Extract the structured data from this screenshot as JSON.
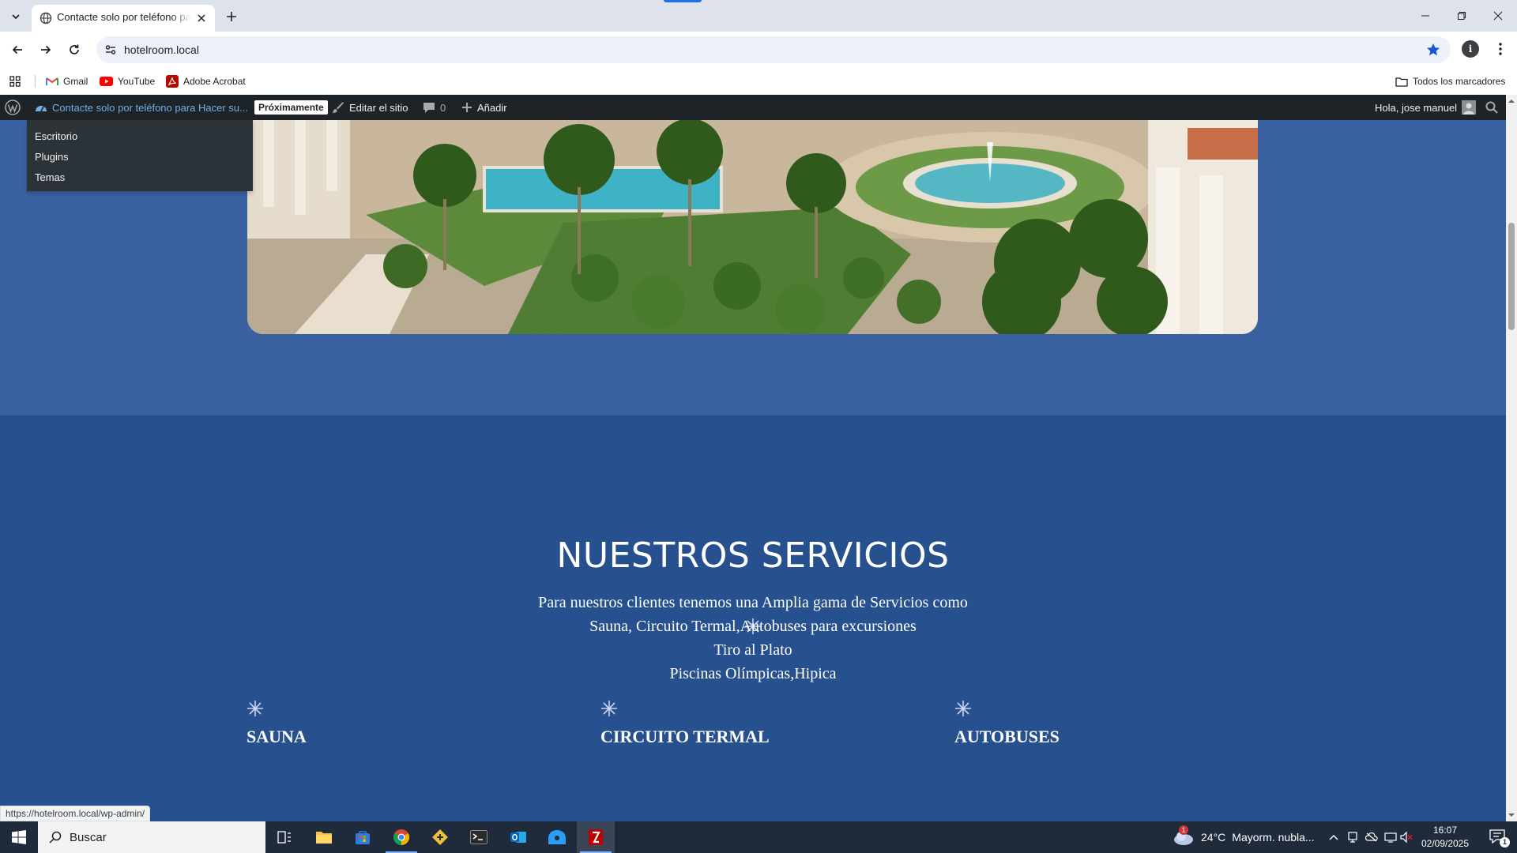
{
  "browser": {
    "tab_title": "Contacte solo por teléfono para Hacer su reserva",
    "url": "hotelroom.local",
    "profile_initial": "i",
    "status_url": "https://hotelroom.local/wp-admin/",
    "bookmarks": [
      {
        "label": "Gmail",
        "icon": "gmail-icon"
      },
      {
        "label": "YouTube",
        "icon": "youtube-icon"
      },
      {
        "label": "Adobe Acrobat",
        "icon": "acrobat-icon"
      }
    ],
    "all_bookmarks_label": "Todos los marcadores"
  },
  "wp_admin_bar": {
    "site_name": "Contacte solo por teléfono para Hacer su...",
    "badge": "Próximamente",
    "edit_site": "Editar el sitio",
    "comments_count": "0",
    "add_new": "Añadir",
    "greeting": "Hola, jose manuel",
    "dropdown": [
      "Escritorio",
      "Plugins",
      "Temas"
    ]
  },
  "services": {
    "title": "NUESTROS SERVICIOS",
    "description": [
      "Para nuestros clientes tenemos una Amplia gama de Servicios como",
      "Sauna, Circuito Termal,Autobuses para excursiones",
      "Tiro al Plato",
      "Piscinas Olímpicas,Hipica"
    ],
    "items": [
      {
        "title": "SAUNA"
      },
      {
        "title": "CIRCUITO TERMAL"
      },
      {
        "title": "AUTOBUSES"
      }
    ]
  },
  "taskbar": {
    "search_placeholder": "Buscar",
    "weather_temp": "24°C",
    "weather_desc": "Mayorm. nubla...",
    "weather_alert": "1",
    "time": "16:07",
    "date": "02/09/2025",
    "notification_count": "1"
  },
  "colors": {
    "hero_band": "#3a61a2",
    "services_bg": "#26508e",
    "wp_bar": "#1d2327",
    "wp_link": "#72aee6"
  }
}
